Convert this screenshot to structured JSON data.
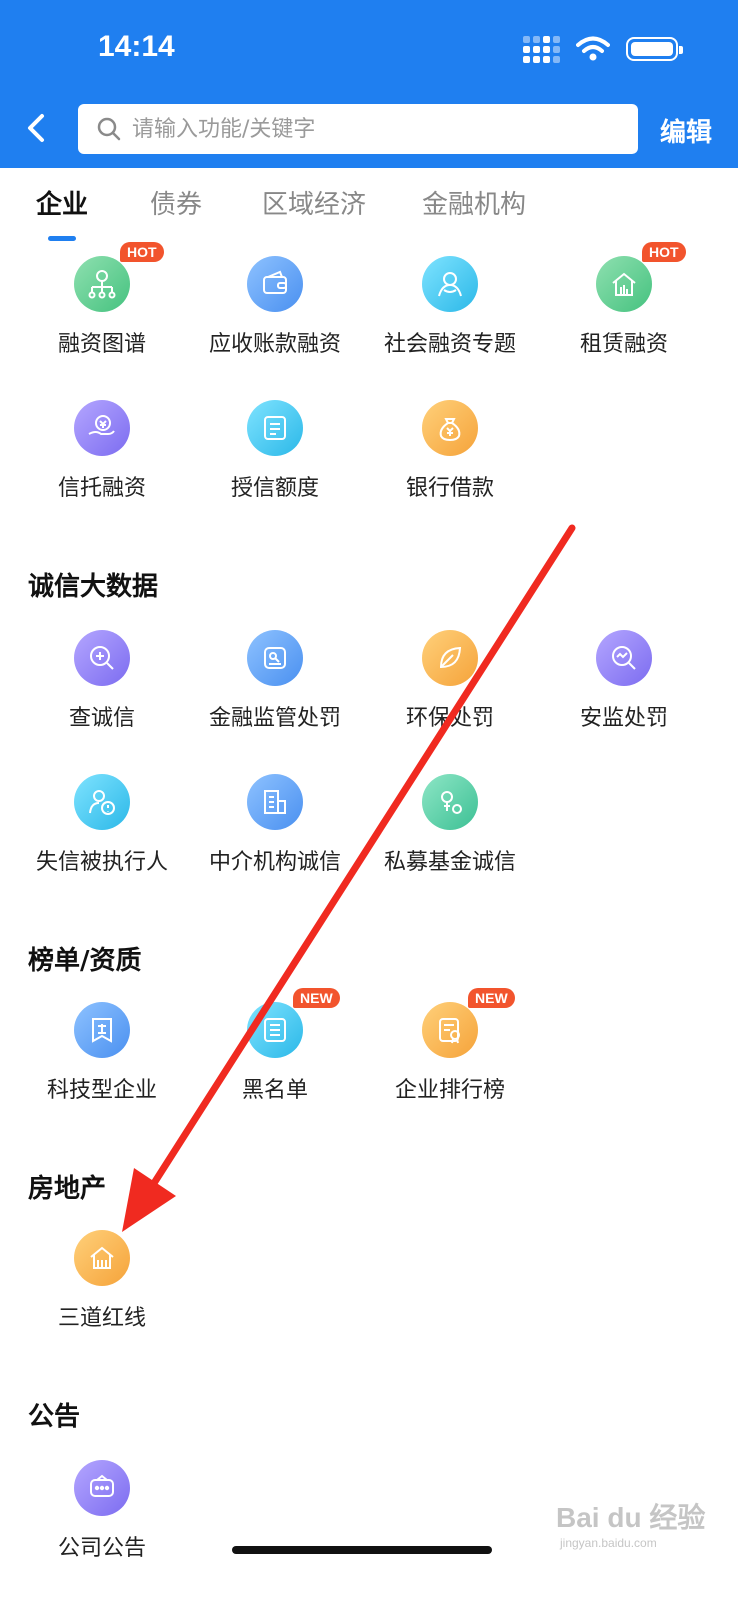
{
  "status": {
    "time": "14:14"
  },
  "header": {
    "search_placeholder": "请输入功能/关键字",
    "edit_label": "编辑"
  },
  "tabs": [
    {
      "label": "企业",
      "active": true
    },
    {
      "label": "债券",
      "active": false
    },
    {
      "label": "区域经济",
      "active": false
    },
    {
      "label": "金融机构",
      "active": false
    }
  ],
  "financing": {
    "items": [
      {
        "label": "融资图谱",
        "badge": "HOT",
        "icon": "financing-map-icon",
        "color": "#45c27f"
      },
      {
        "label": "应收账款融资",
        "icon": "wallet-icon",
        "color": "#4a90f0"
      },
      {
        "label": "社会融资专题",
        "icon": "people-icon",
        "color": "#2bb8e8"
      },
      {
        "label": "租赁融资",
        "badge": "HOT",
        "icon": "building-icon",
        "color": "#45c27f"
      },
      {
        "label": "信托融资",
        "icon": "hand-coin-icon",
        "color": "#7c6cf0"
      },
      {
        "label": "授信额度",
        "icon": "credit-doc-icon",
        "color": "#2bb8e8"
      },
      {
        "label": "银行借款",
        "icon": "money-bag-icon",
        "color": "#f5a33a"
      }
    ]
  },
  "credit": {
    "title": "诚信大数据",
    "items": [
      {
        "label": "查诚信",
        "icon": "search-credit-icon",
        "color": "#7c6cf0"
      },
      {
        "label": "金融监管处罚",
        "icon": "regulation-icon",
        "color": "#4a90f0"
      },
      {
        "label": "环保处罚",
        "icon": "leaf-icon",
        "color": "#f5a33a"
      },
      {
        "label": "安监处罚",
        "icon": "inspect-icon",
        "color": "#7c6cf0"
      },
      {
        "label": "失信被执行人",
        "icon": "person-alert-icon",
        "color": "#2bb8e8"
      },
      {
        "label": "中介机构诚信",
        "icon": "agency-icon",
        "color": "#4a90f0"
      },
      {
        "label": "私募基金诚信",
        "icon": "private-fund-icon",
        "color": "#3cc094"
      }
    ]
  },
  "ranking": {
    "title": "榜单/资质",
    "items": [
      {
        "label": "科技型企业",
        "icon": "enterprise-icon",
        "color": "#4a90f0"
      },
      {
        "label": "黑名单",
        "badge": "NEW",
        "icon": "blacklist-icon",
        "color": "#2bb8e8"
      },
      {
        "label": "企业排行榜",
        "badge": "NEW",
        "icon": "ranking-icon",
        "color": "#f5a33a"
      }
    ]
  },
  "realestate": {
    "title": "房地产",
    "items": [
      {
        "label": "三道红线",
        "icon": "house-icon",
        "color": "#f5a33a"
      }
    ]
  },
  "announce": {
    "title": "公告",
    "items": [
      {
        "label": "公司公告",
        "icon": "chat-icon",
        "color": "#7c6cf0"
      }
    ]
  },
  "watermark": {
    "text": "Bai du 经验",
    "sub": "jingyan.baidu.com"
  }
}
